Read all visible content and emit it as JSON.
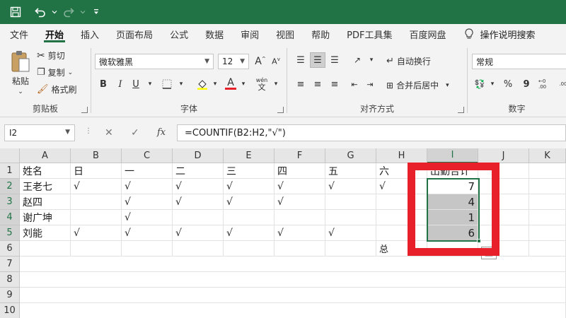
{
  "quick_access": {
    "save_icon": "save-icon",
    "undo_icon": "undo-icon",
    "redo_icon": "redo-icon",
    "customize_icon": "customize-qat-icon"
  },
  "menu": {
    "tabs": [
      "文件",
      "开始",
      "插入",
      "页面布局",
      "公式",
      "数据",
      "审阅",
      "视图",
      "帮助",
      "PDF工具集",
      "百度网盘"
    ],
    "active": "开始",
    "tell_me": "操作说明搜索"
  },
  "ribbon": {
    "clipboard": {
      "label": "剪贴板",
      "paste": "粘贴",
      "cut": "剪切",
      "copy": "复制",
      "format_painter": "格式刷"
    },
    "font": {
      "label": "字体",
      "font_name": "微软雅黑",
      "font_size": "12",
      "bold": "B",
      "italic": "I",
      "underline": "U",
      "font_color_letter": "A",
      "phonetic": "wén"
    },
    "alignment": {
      "label": "对齐方式",
      "wrap_text": "自动换行",
      "merge_center": "合并后居中"
    },
    "number": {
      "label": "数字",
      "format": "常规",
      "percent": "%",
      "comma": "9",
      "decimal_inc": "←0 .00",
      "decimal_dec": ".00"
    },
    "colors": {
      "excel_green": "#217346",
      "highlight_yellow": "#ffff00",
      "font_red": "#e8202a"
    }
  },
  "formula_bar": {
    "name_box": "I2",
    "formula": "=COUNTIF(B2:H2,\"√\")",
    "fx": "fx"
  },
  "sheet": {
    "columns": [
      "A",
      "B",
      "C",
      "D",
      "E",
      "F",
      "G",
      "H",
      "I",
      "J",
      "K"
    ],
    "selected_column": "I",
    "rows": [
      "1",
      "2",
      "3",
      "4",
      "5",
      "6",
      "7",
      "8",
      "9",
      "10"
    ],
    "header_row": [
      "姓名",
      "日",
      "一",
      "二",
      "三",
      "四",
      "五",
      "六",
      "出勤合计"
    ],
    "data": [
      [
        "王老七",
        "√",
        "√",
        "√",
        "√",
        "√",
        "√",
        "√",
        "7"
      ],
      [
        "赵四",
        "",
        "√",
        "√",
        "√",
        "√",
        "",
        "",
        "4"
      ],
      [
        "谢广坤",
        "",
        "√",
        "",
        "",
        "",
        "",
        "",
        "1"
      ],
      [
        "刘能",
        "√",
        "√",
        "√",
        "√",
        "√",
        "√",
        "",
        "6"
      ]
    ],
    "row6_h": "总",
    "highlight_color": "#e8202a"
  }
}
